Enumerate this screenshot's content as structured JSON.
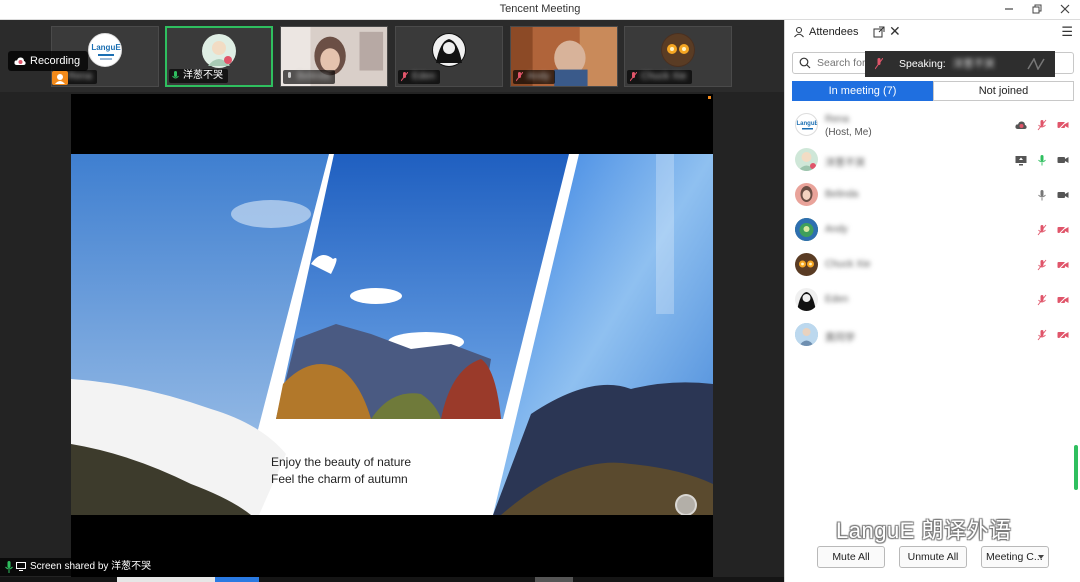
{
  "window": {
    "title": "Tencent Meeting"
  },
  "recording": {
    "label": "Recording"
  },
  "thumbnails": [
    {
      "name": "Rena",
      "kind": "logo"
    },
    {
      "name": "洋葱不哭",
      "kind": "avatar",
      "active": true
    },
    {
      "name": "Belinda",
      "kind": "photo"
    },
    {
      "name": "Eden",
      "kind": "bw"
    },
    {
      "name": "Andy",
      "kind": "photo2"
    },
    {
      "name": "Chuck Xie",
      "kind": "glow"
    }
  ],
  "logo_text": "LanguE",
  "slide": {
    "line1": "Enjoy the beauty of nature",
    "line2": "Feel the charm of autumn"
  },
  "shared_by": {
    "label": "Screen shared by 洋葱不哭"
  },
  "panel": {
    "title": "Attendees",
    "search_placeholder": "Search for",
    "speaking_label": "Speaking:",
    "speaking_name": "洋葱不哭",
    "tabs": [
      {
        "label": "In meeting (7)",
        "active": true
      },
      {
        "label": "Not joined",
        "active": false
      }
    ],
    "attendees": [
      {
        "name": "Rena",
        "role": "(Host, Me)",
        "avatar_color": "#e9f3fb",
        "mic": "muted",
        "camera": "off",
        "extra": "cloud"
      },
      {
        "name": "洋葱不哭",
        "role": "",
        "avatar_color": "#cfe7d8",
        "mic": "active",
        "camera": "on",
        "extra": "screen"
      },
      {
        "name": "Belinda",
        "role": "",
        "avatar_color": "#e9a39a",
        "mic": "on",
        "camera": "on",
        "extra": ""
      },
      {
        "name": "Andy",
        "role": "",
        "avatar_color": "#3f7f5a",
        "mic": "muted",
        "camera": "off",
        "extra": ""
      },
      {
        "name": "Chuck Xie",
        "role": "",
        "avatar_color": "#6b4a2e",
        "mic": "muted",
        "camera": "off",
        "extra": ""
      },
      {
        "name": "Eden",
        "role": "",
        "avatar_color": "#2a2a2a",
        "mic": "muted",
        "camera": "off",
        "extra": ""
      },
      {
        "name": "黄同学",
        "role": "",
        "avatar_color": "#9cc6e3",
        "mic": "muted",
        "camera": "off",
        "extra": ""
      }
    ],
    "buttons": {
      "mute_all": "Mute All",
      "unmute_all": "Unmute All",
      "meeting_controls": "Meeting C..."
    }
  },
  "watermark": {
    "text": "LanguE 朗译外语"
  },
  "colors": {
    "accent_blue": "#1f6fe0",
    "active_green": "#2fbf5f",
    "muted_red": "#e0556a",
    "orange": "#f28a1b"
  }
}
